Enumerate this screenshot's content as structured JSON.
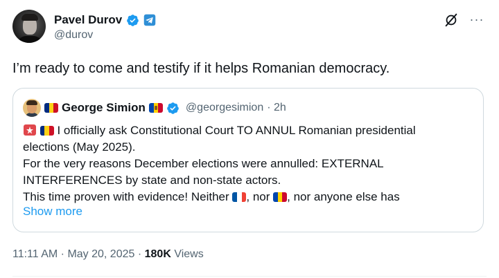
{
  "author": {
    "name": "Pavel Durov",
    "handle": "@durov"
  },
  "tweet": {
    "text": "I’m ready to come and testify if it helps Romanian democracy."
  },
  "quoted": {
    "name": "George Simion",
    "handle": "@georgesimion",
    "time": "· 2h",
    "line1": "I officially ask Constitutional Court TO ANNUL Romanian presidential",
    "line2": "elections (May 2025).",
    "line3": "For the very reasons December elections were annulled: EXTERNAL",
    "line4": "INTERFERENCES by state and non-state actors.",
    "line5_a": "This time proven with evidence! Neither",
    "line5_b": ", nor",
    "line5_c": ", nor anyone else has",
    "show_more": "Show more"
  },
  "meta": {
    "timestamp": "11:11 AM · May 20, 2025 ·",
    "views_count": "180K",
    "views_label": "Views"
  },
  "colors": {
    "verified_blue": "#1d9bf0",
    "link_blue": "#1d9bf0",
    "secondary_text": "#536471",
    "romania_flag": [
      "#002b7f",
      "#fcd116",
      "#ce1126"
    ],
    "france_flag": [
      "#0055a4",
      "#ffffff",
      "#ef4135"
    ]
  },
  "icons": {
    "verified": "verified-badge-icon",
    "telegram": "telegram-icon",
    "grok": "grok-icon",
    "more": "more-icon",
    "siren": "police-light-emoji"
  }
}
